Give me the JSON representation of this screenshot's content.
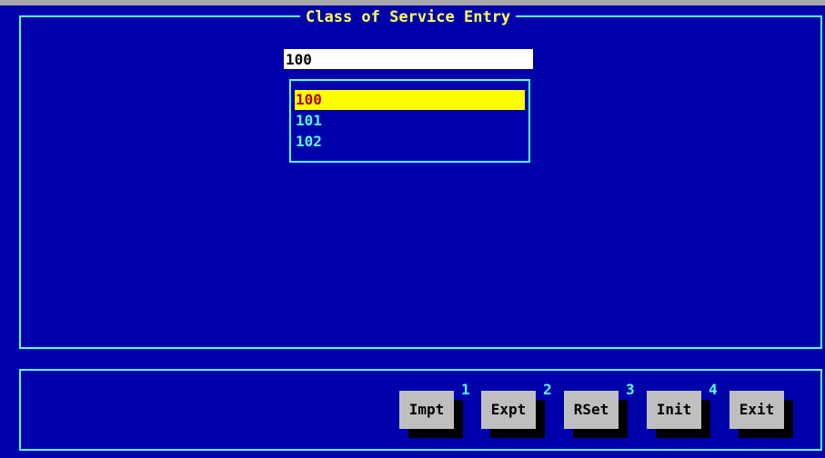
{
  "window": {
    "title": "Class of Service Entry"
  },
  "entry": {
    "value": "100"
  },
  "list": {
    "items": [
      "100",
      "101",
      "102"
    ],
    "selected_index": 0
  },
  "buttons": [
    {
      "label": "Impt",
      "hotkey": "1"
    },
    {
      "label": "Expt",
      "hotkey": "2"
    },
    {
      "label": "RSet",
      "hotkey": "3"
    },
    {
      "label": "Init",
      "hotkey": "4"
    },
    {
      "label": "Exit"
    }
  ],
  "colors": {
    "background": "#0000aa",
    "frame": "#55ffff",
    "title": "#ffff55",
    "selection_bg": "#ffff00",
    "selection_fg": "#aa0000",
    "button": "#bfbfbf"
  }
}
